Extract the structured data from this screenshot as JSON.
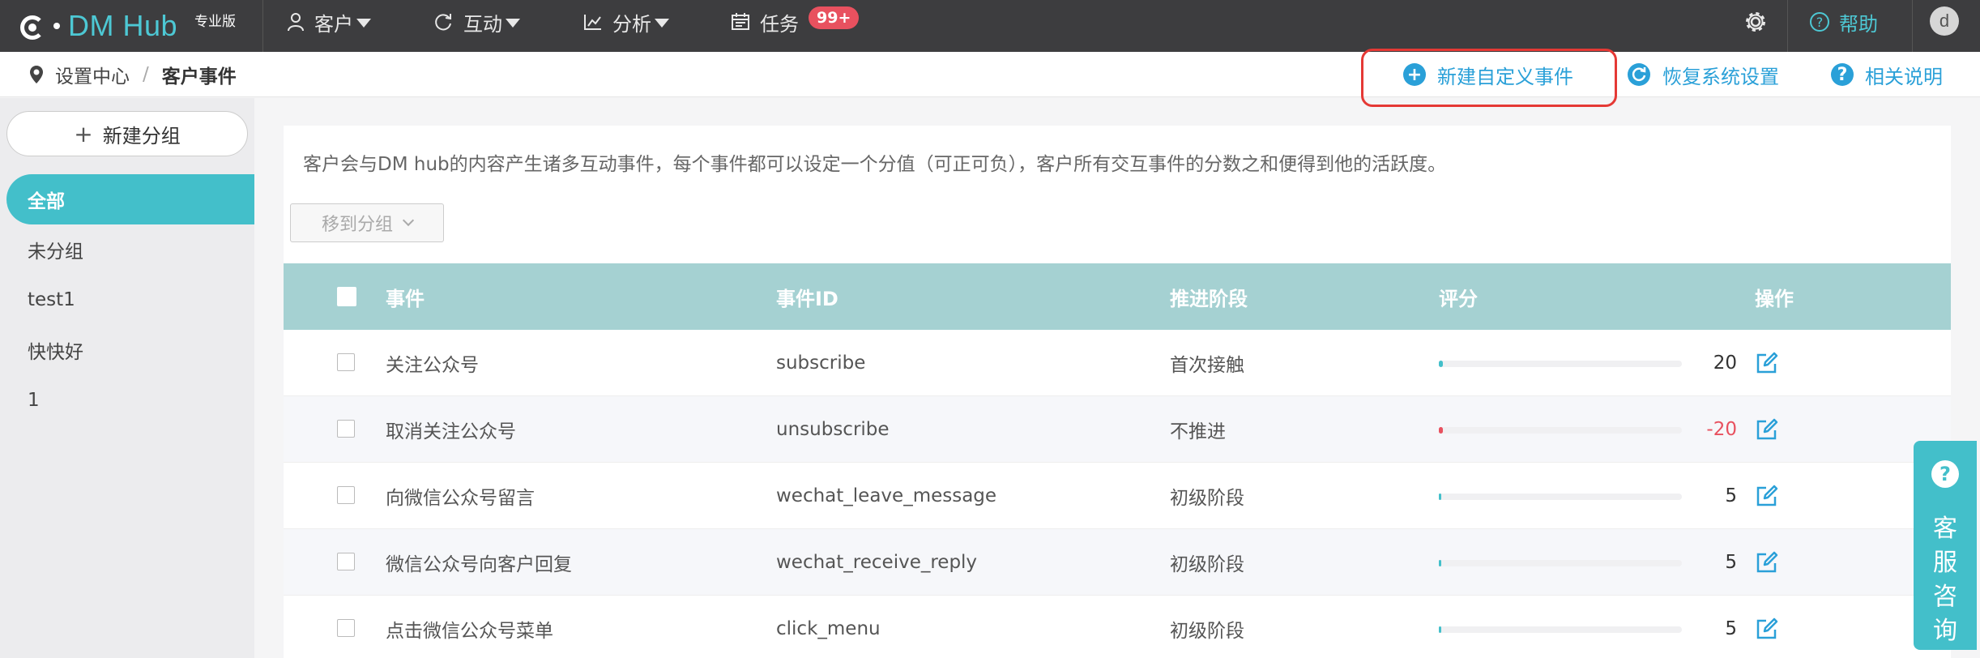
{
  "topnav": {
    "brand": "DM Hub",
    "edition": "专业版",
    "items": [
      {
        "label": "客户",
        "icon": "user-icon"
      },
      {
        "label": "互动",
        "icon": "refresh-icon"
      },
      {
        "label": "分析",
        "icon": "chart-icon"
      },
      {
        "label": "任务",
        "icon": "calendar-icon"
      }
    ],
    "task_badge": "99+",
    "help_label": "帮助",
    "avatar_letter": "d"
  },
  "breadcrumb": {
    "parent": "设置中心",
    "separator": "/",
    "current": "客户事件"
  },
  "actions": {
    "new_event": "新建自定义事件",
    "restore": "恢复系统设置",
    "help": "相关说明"
  },
  "sidebar": {
    "new_group": "新建分组",
    "groups": [
      {
        "label": "全部",
        "active": true
      },
      {
        "label": "未分组",
        "active": false
      },
      {
        "label": "test1",
        "active": false
      },
      {
        "label": "快快好",
        "active": false
      },
      {
        "label": "1",
        "active": false
      }
    ]
  },
  "main": {
    "description": "客户会与DM hub的内容产生诸多互动事件，每个事件都可以设定一个分值（可正可负），客户所有交互事件的分数之和便得到他的活跃度。",
    "move_button": "移到分组",
    "columns": [
      "事件",
      "事件ID",
      "推进阶段",
      "评分",
      "操作"
    ],
    "rows": [
      {
        "event": "关注公众号",
        "id": "subscribe",
        "stage": "首次接触",
        "score": "20",
        "level": 0.02
      },
      {
        "event": "取消关注公众号",
        "id": "unsubscribe",
        "stage": "不推进",
        "score": "-20",
        "level": -0.02
      },
      {
        "event": "向微信公众号留言",
        "id": "wechat_leave_message",
        "stage": "初级阶段",
        "score": "5",
        "level": 0.005
      },
      {
        "event": "微信公众号向客户回复",
        "id": "wechat_receive_reply",
        "stage": "初级阶段",
        "score": "5",
        "level": 0.005
      },
      {
        "event": "点击微信公众号菜单",
        "id": "click_menu",
        "stage": "初级阶段",
        "score": "5",
        "level": 0.005
      }
    ]
  },
  "service_widget": {
    "label": "客服咨询"
  },
  "colors": {
    "accent": "#43bfca",
    "link": "#2aa0d8",
    "negative": "#e8515f",
    "header": "#a5d1d2"
  }
}
